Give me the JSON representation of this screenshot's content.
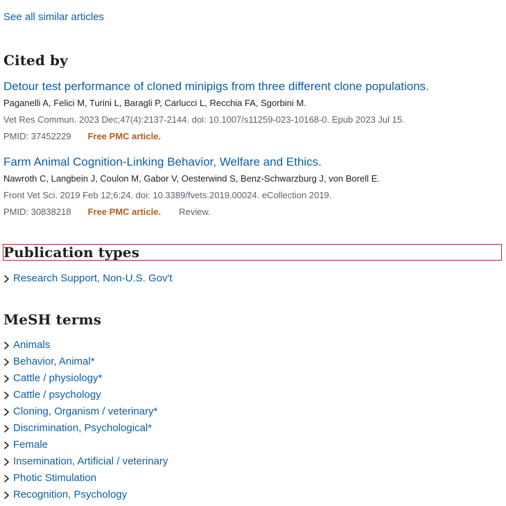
{
  "similar": {
    "see_all_label": "See all similar articles"
  },
  "cited_by": {
    "heading": "Cited by",
    "articles": [
      {
        "title": "Detour test performance of cloned minipigs from three different clone populations.",
        "authors": "Paganelli A, Felici M, Turini L, Baragli P, Carlucci L, Recchia FA, Sgorbini M.",
        "citation": "Vet Res Commun. 2023 Dec;47(4):2137-2144. doi: 10.1007/s11259-023-10168-0. Epub 2023 Jul 15.",
        "pmid": "PMID: 37452229",
        "free_pmc": "Free PMC article.",
        "review": ""
      },
      {
        "title": "Farm Animal Cognition-Linking Behavior, Welfare and Ethics.",
        "authors": "Nawroth C, Langbein J, Coulon M, Gabor V, Oesterwind S, Benz-Schwarzburg J, von Borell E.",
        "citation": "Front Vet Sci. 2019 Feb 12;6:24. doi: 10.3389/fvets.2019.00024. eCollection 2019.",
        "pmid": "PMID: 30838218",
        "free_pmc": "Free PMC article.",
        "review": "Review."
      }
    ]
  },
  "publication_types": {
    "heading": "Publication types",
    "items": [
      "Research Support, Non-U.S. Gov't"
    ]
  },
  "mesh_terms": {
    "heading": "MeSH terms",
    "items": [
      "Animals",
      "Behavior, Animal*",
      "Cattle / physiology*",
      "Cattle / psychology",
      "Cloning, Organism / veterinary*",
      "Discrimination, Psychological*",
      "Female",
      "Insemination, Artificial / veterinary",
      "Photic Stimulation",
      "Recognition, Psychology"
    ]
  },
  "colors": {
    "link": "#0b5ea8",
    "free_pmc": "#b35a1f",
    "muted": "#5b616b",
    "highlight_border": "#b22222"
  },
  "icons": {
    "list_bullet": "chevron-right-icon"
  }
}
